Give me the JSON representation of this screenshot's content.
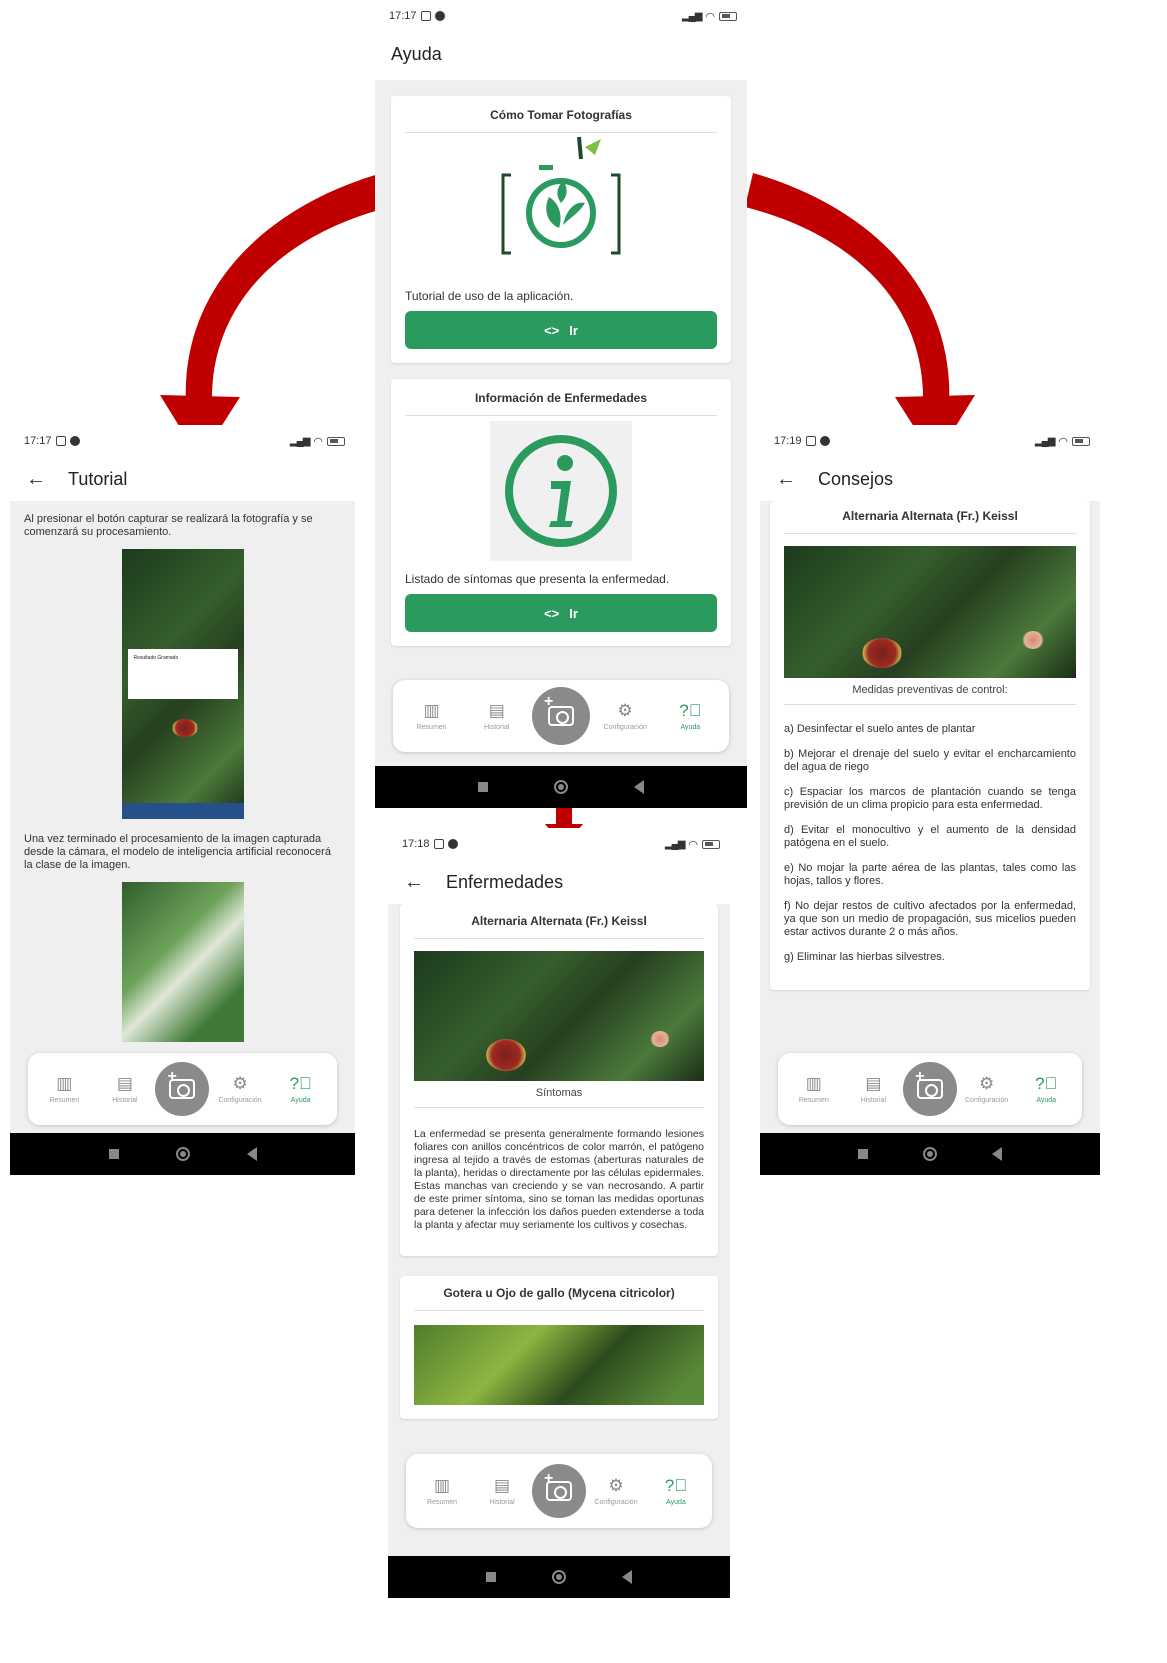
{
  "nav": {
    "items": [
      {
        "label": "Resumen"
      },
      {
        "label": "Historial"
      },
      {
        "label": "Configuración"
      },
      {
        "label": "Ayuda"
      }
    ],
    "accent": "#2a9a5f"
  },
  "ayuda": {
    "time": "17:17",
    "title": "Ayuda",
    "card1": {
      "title": "Cómo Tomar Fotografías",
      "text": "Tutorial de uso de la aplicación.",
      "button": "Ir"
    },
    "card2": {
      "title": "Información de Enfermedades",
      "text": "Listado de síntomas que presenta la enfermedad.",
      "button": "Ir"
    }
  },
  "tutorial": {
    "time": "17:17",
    "title": "Tutorial",
    "para1": "Al presionar el botón capturar se realizará la fotografía y se comenzará su procesamiento.",
    "dialog_text": "Resultado Gramado",
    "para2": "Una vez terminado el procesamiento de la imagen capturada desde la cámara, el modelo de inteligencia artificial reconocerá la clase de la imagen."
  },
  "enfermedades": {
    "time": "17:18",
    "title": "Enfermedades",
    "card1": {
      "title": "Alternaria Alternata (Fr.) Keissl",
      "caption": "Síntomas",
      "text": "La enfermedad se presenta generalmente formando lesiones foliares con anillos concéntricos de color marrón, el patógeno ingresa al tejido a través de estomas (aberturas naturales de la planta), heridas o directamente por las células epidermales. Estas manchas van creciendo y se van necrosando. A partir de este primer síntoma, sino se toman las medidas oportunas para detener la infección los daños pueden extenderse a toda la planta y afectar muy seriamente los cultivos y cosechas."
    },
    "card2": {
      "title": "Gotera u Ojo de gallo (Mycena citricolor)"
    }
  },
  "consejos": {
    "time": "17:19",
    "title": "Consejos",
    "card_title": "Alternaria Alternata (Fr.) Keissl",
    "caption": "Medidas preventivas de control:",
    "items": [
      "a) Desinfectar el suelo antes de plantar",
      "b) Mejorar el drenaje del suelo y evitar el encharcamiento del agua de riego",
      "c) Espaciar los marcos de plantación cuando se tenga previsión de un clima propicio para esta enfermedad.",
      "d) Evitar el monocultivo y el aumento de la densidad patógena en el suelo.",
      "e) No mojar la parte aérea de las plantas, tales como las hojas, tallos y flores.",
      "f) No dejar restos de cultivo afectados por la enfermedad, ya que son un medio de propagación, sus micelios pueden estar activos durante 2 o más años.",
      "g) Eliminar las hierbas silvestres."
    ]
  },
  "colors": {
    "arrow": "#c00000",
    "button": "#2a9a5f"
  }
}
